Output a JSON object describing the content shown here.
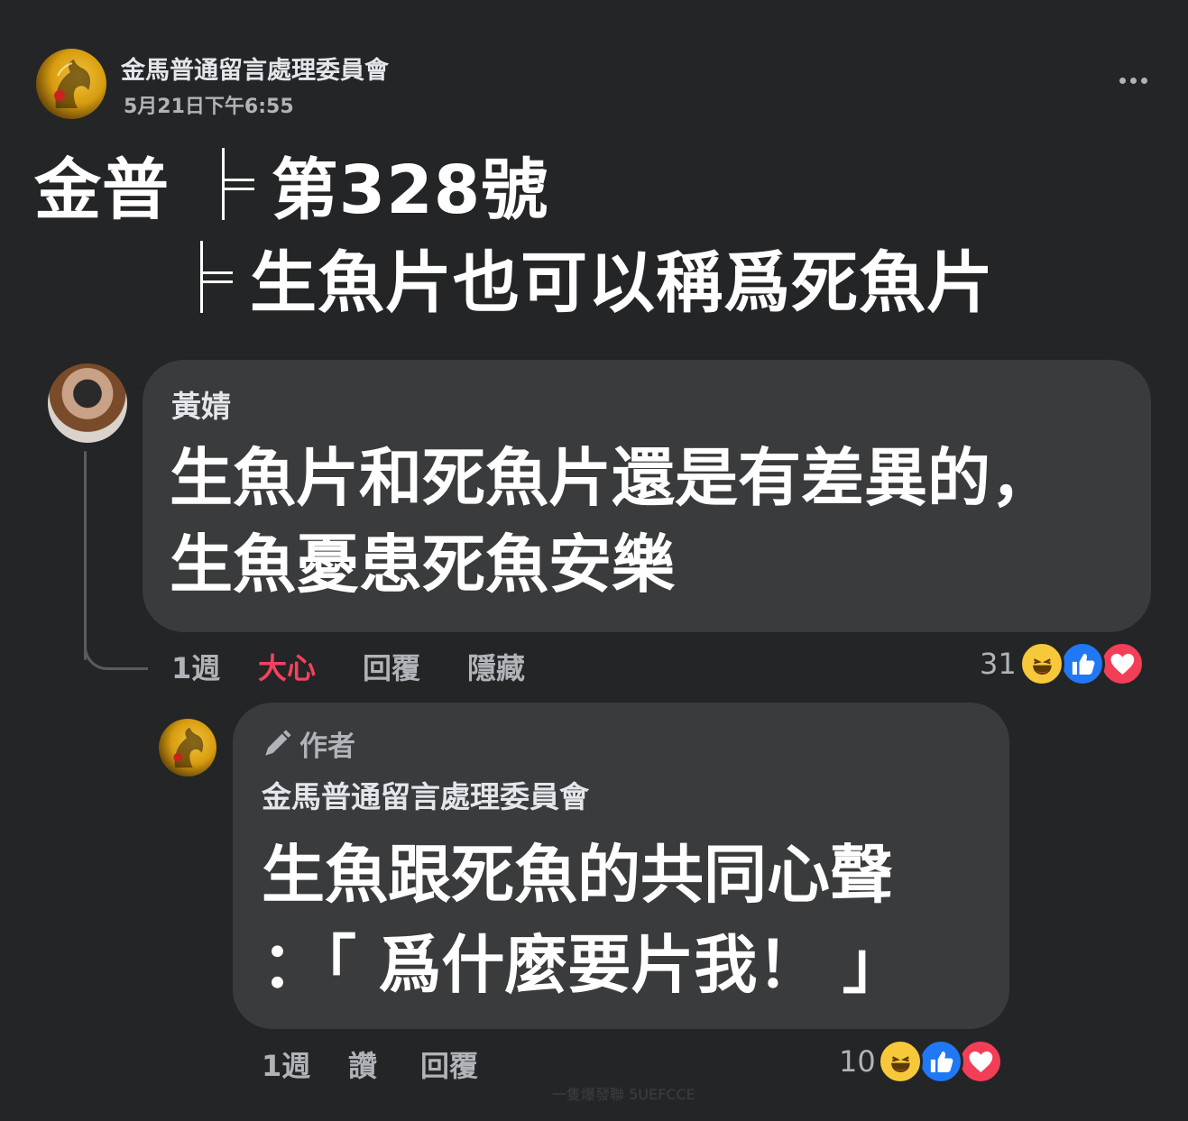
{
  "post": {
    "page_name": "金馬普通留言處理委員會",
    "timestamp": "5月21日下午6:55",
    "line1_prefix": "金普",
    "line1_text": "第328號",
    "line2_text": "生魚片也可以稱爲死魚片"
  },
  "comment1": {
    "author": "黃婧",
    "text": "生魚片和死魚片還是有差異的，\n生魚憂患死魚安樂",
    "time": "1週",
    "heart_label": "大心",
    "reply_label": "回覆",
    "hide_label": "隱藏",
    "reaction_count": "31",
    "reactions": [
      "haha-icon",
      "like-icon",
      "love-icon"
    ]
  },
  "comment2": {
    "author_badge": "作者",
    "author": "金馬普通留言處理委員會",
    "text": "生魚跟死魚的共同心聲\n：「 爲什麼要片我！ 」",
    "time": "1週",
    "like_label": "讚",
    "reply_label": "回覆",
    "reaction_count": "10",
    "reactions": [
      "haha-icon",
      "like-icon",
      "love-icon"
    ]
  },
  "watermark": "一隻爆發聯 5UEFCCE",
  "colors": {
    "background": "#242526",
    "bubble": "#3a3b3c",
    "text_primary": "#e4e6eb",
    "text_secondary": "#b0b3b8",
    "heart_red": "#f3425f",
    "like_blue": "#2078f4",
    "haha_yellow": "#f7c83a"
  }
}
